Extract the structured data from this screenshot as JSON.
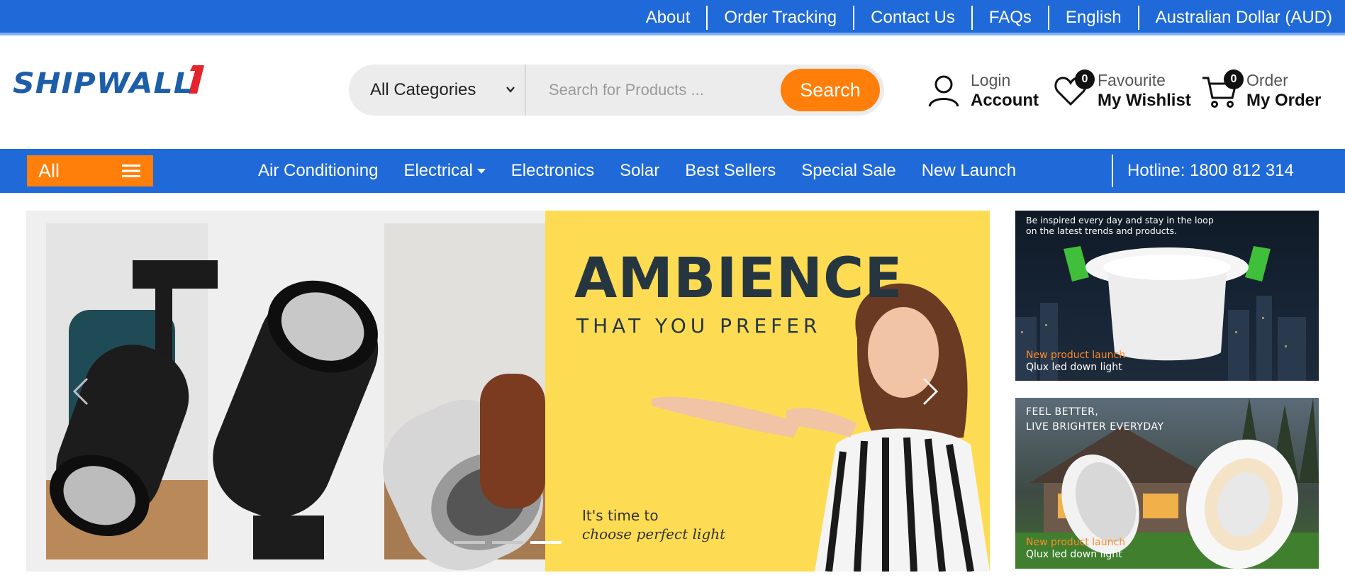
{
  "topbar": {
    "links": [
      "About",
      "Order Tracking",
      "Contact Us",
      "FAQs",
      "English",
      "Australian Dollar (AUD)"
    ]
  },
  "header": {
    "logo_text": "SHIPWALL",
    "category_select": "All Categories",
    "search_placeholder": "Search for Products ...",
    "search_button": "Search",
    "account": {
      "small": "Login",
      "big": "Account"
    },
    "wishlist": {
      "small": "Favourite",
      "big": "My Wishlist",
      "count": "0"
    },
    "order": {
      "small": "Order",
      "big": "My Order",
      "count": "0"
    }
  },
  "nav": {
    "all_label": "All",
    "items": [
      "Air Conditioning",
      "Electrical",
      "Electronics",
      "Solar",
      "Best Sellers",
      "Special Sale",
      "New Launch"
    ],
    "hotline": "Hotline: 1800 812 314"
  },
  "hero": {
    "title": "AMBIENCE",
    "subtitle": "THAT YOU PREFER",
    "note_line1": "It's time to",
    "note_line2": "choose perfect light",
    "slides": 3,
    "active_slide": 3
  },
  "promos": [
    {
      "headline": "Be inspired every day and stay in the loop on the latest trends and products.",
      "tag": "New product launch",
      "product": "Qlux led down light"
    },
    {
      "headline_line1": "FEEL BETTER,",
      "headline_line2": "LIVE BRIGHTER EVERYDAY",
      "tag": "New product launch",
      "product": "Qlux led down light"
    }
  ],
  "colors": {
    "primary_blue": "#1f6ad8",
    "accent_orange": "#ff7f0a",
    "hero_yellow": "#fddc54",
    "text_dark": "#263641"
  }
}
